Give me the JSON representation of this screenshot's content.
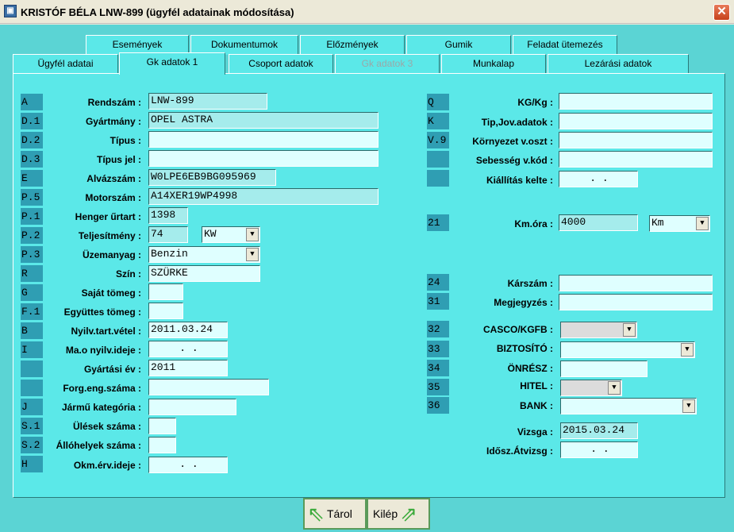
{
  "window": {
    "title": "KRISTÓF BÉLA   LNW-899 (ügyfél adatainak módosítása)",
    "close": "✕",
    "icon": "app-icon"
  },
  "tabs_row1": [
    "Események",
    "Dokumentumok",
    "Előzmények",
    "Gumik",
    "Feladat ütemezés"
  ],
  "tabs_row2": [
    "Ügyfél adatai",
    "Gk adatok 1",
    "Csoport adatok",
    "Gk adatok 3",
    "Munkalap",
    "Lezárási adatok"
  ],
  "left": [
    {
      "code": "A",
      "label": "Rendszám :",
      "value": "LNW-899"
    },
    {
      "code": "D.1",
      "label": "Gyártmány :",
      "value": "OPEL ASTRA"
    },
    {
      "code": "D.2",
      "label": "Típus :",
      "value": ""
    },
    {
      "code": "D.3",
      "label": "Típus jel :",
      "value": ""
    },
    {
      "code": "E",
      "label": "Alvázszám :",
      "value": "W0LPE6EB9BG095969"
    },
    {
      "code": "P.5",
      "label": "Motorszám :",
      "value": "A14XER19WP4998"
    },
    {
      "code": "P.1",
      "label": "Henger űrtart :",
      "value": "1398"
    },
    {
      "code": "P.2",
      "label": "Teljesítmény :",
      "value": "74",
      "unit": "KW"
    },
    {
      "code": "P.3",
      "label": "Üzemanyag :",
      "value": "Benzin"
    },
    {
      "code": "R",
      "label": "Szín :",
      "value": "SZÜRKE"
    },
    {
      "code": "G",
      "label": "Saját tömeg :",
      "value": ""
    },
    {
      "code": "F.1",
      "label": "Együttes tömeg :",
      "value": ""
    },
    {
      "code": "B",
      "label": "Nyilv.tart.vétel :",
      "value": "2011.03.24"
    },
    {
      "code": "I",
      "label": "Ma.o nyilv.ideje :",
      "value": ". ."
    },
    {
      "code": "",
      "label": "Gyártási év :",
      "value": "2011"
    },
    {
      "code": "",
      "label": "Forg.eng.száma :",
      "value": ""
    },
    {
      "code": "J",
      "label": "Jármű kategória :",
      "value": ""
    },
    {
      "code": "S.1",
      "label": "Ülések száma :",
      "value": ""
    },
    {
      "code": "S.2",
      "label": "Állóhelyek száma :",
      "value": ""
    },
    {
      "code": "H",
      "label": "Okm.érv.ideje :",
      "value": ". ."
    }
  ],
  "right": [
    {
      "code": "Q",
      "label": "KG/Kg :",
      "value": ""
    },
    {
      "code": "K",
      "label": "Tip,Jov.adatok :",
      "value": ""
    },
    {
      "code": "V.9",
      "label": "Környezet v.oszt :",
      "value": ""
    },
    {
      "code": "",
      "label": "Sebesség v.kód :",
      "value": ""
    },
    {
      "code": "",
      "label": "Kiállítás kelte :",
      "value": ". ."
    },
    {
      "code": "21",
      "label": "Km.óra :",
      "value": "4000",
      "unit": "Km"
    },
    {
      "code": "24",
      "label": "Kárszám :",
      "value": ""
    },
    {
      "code": "31",
      "label": "Megjegyzés :",
      "value": ""
    },
    {
      "code": "32",
      "label": "CASCO/KGFB :",
      "value": ""
    },
    {
      "code": "33",
      "label": "BIZTOSÍTÓ :",
      "value": ""
    },
    {
      "code": "34",
      "label": "ÖNRÉSZ :",
      "value": ""
    },
    {
      "code": "35",
      "label": "HITEL :",
      "value": ""
    },
    {
      "code": "36",
      "label": "BANK :",
      "value": ""
    },
    {
      "code": "",
      "label": "Vizsga :",
      "value": "2015.03.24"
    },
    {
      "code": "",
      "label": "Idősz.Átvizsg :",
      "value": ". ."
    }
  ],
  "buttons": {
    "save": "Tárol",
    "exit": "Kilép"
  },
  "dropdown_arrow": "▼"
}
